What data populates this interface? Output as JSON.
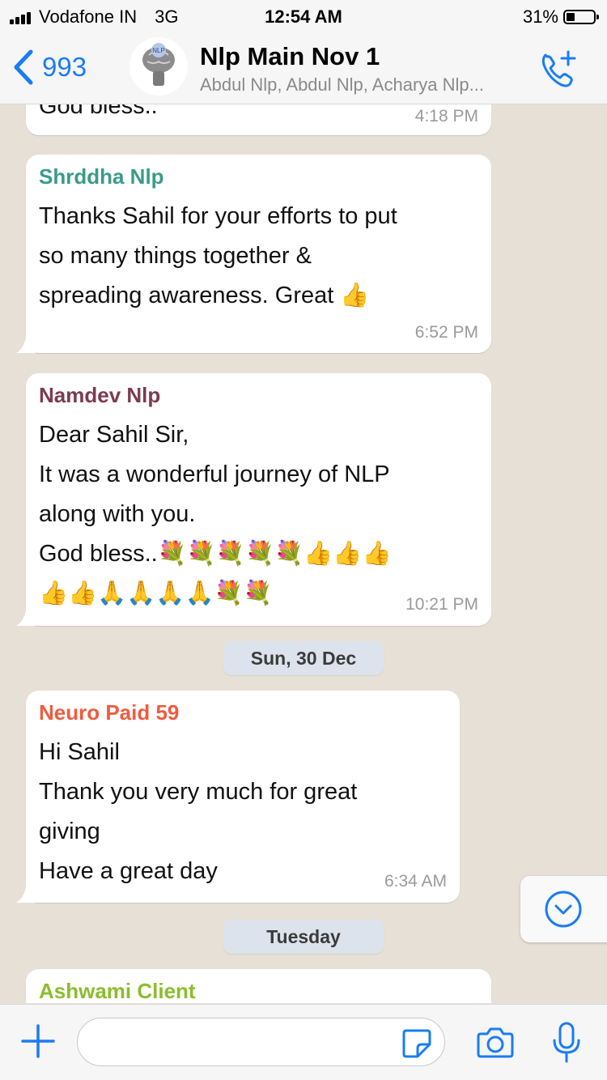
{
  "status_bar": {
    "carrier": "Vodafone IN",
    "network": "3G",
    "time": "12:54 AM",
    "battery_percent": "31%",
    "battery_level": 0.31
  },
  "header": {
    "back_count": "993",
    "title": "Nlp Main Nov 1",
    "members": "Abdul Nlp, Abdul Nlp, Acharya Nlp...",
    "avatar_text": "NLP"
  },
  "messages": [
    {
      "sender": "",
      "lines": [
        "God bless.."
      ],
      "time": "4:18 PM"
    },
    {
      "sender": "Shrddha Nlp",
      "sender_color": "#3a9b8a",
      "lines": [
        "Thanks Sahil for your efforts to put",
        "so many things together &",
        "spreading awareness. Great 👍"
      ],
      "time": "6:52 PM"
    },
    {
      "sender": "Namdev Nlp",
      "sender_color": "#7b3b52",
      "lines": [
        "Dear Sahil Sir,",
        "It was a wonderful journey of NLP",
        "along with you.",
        "God bless..💐💐💐💐💐👍👍👍",
        "👍👍🙏🙏🙏🙏💐💐"
      ],
      "time": "10:21 PM"
    },
    {
      "sender": "Neuro Paid 59",
      "sender_color": "#ef5c3f",
      "lines": [
        "Hi Sahil",
        "Thank you very much for great",
        "giving",
        "Have a great day"
      ],
      "time": "6:34 AM"
    },
    {
      "sender": "Ashwami Client",
      "sender_color": "#8bbd2c",
      "lines": [],
      "time": ""
    }
  ],
  "date_separators": [
    "Sun, 30 Dec",
    "Tuesday"
  ],
  "input": {
    "placeholder": ""
  },
  "colors": {
    "accent": "#1a7cf5",
    "chat_background": "#e7e0d6",
    "date_pill": "#dde3ec"
  },
  "icons": [
    "back-chevron-icon",
    "add-participant-call-icon",
    "scroll-down-icon",
    "plus-icon",
    "sticker-icon",
    "camera-icon",
    "microphone-icon"
  ]
}
